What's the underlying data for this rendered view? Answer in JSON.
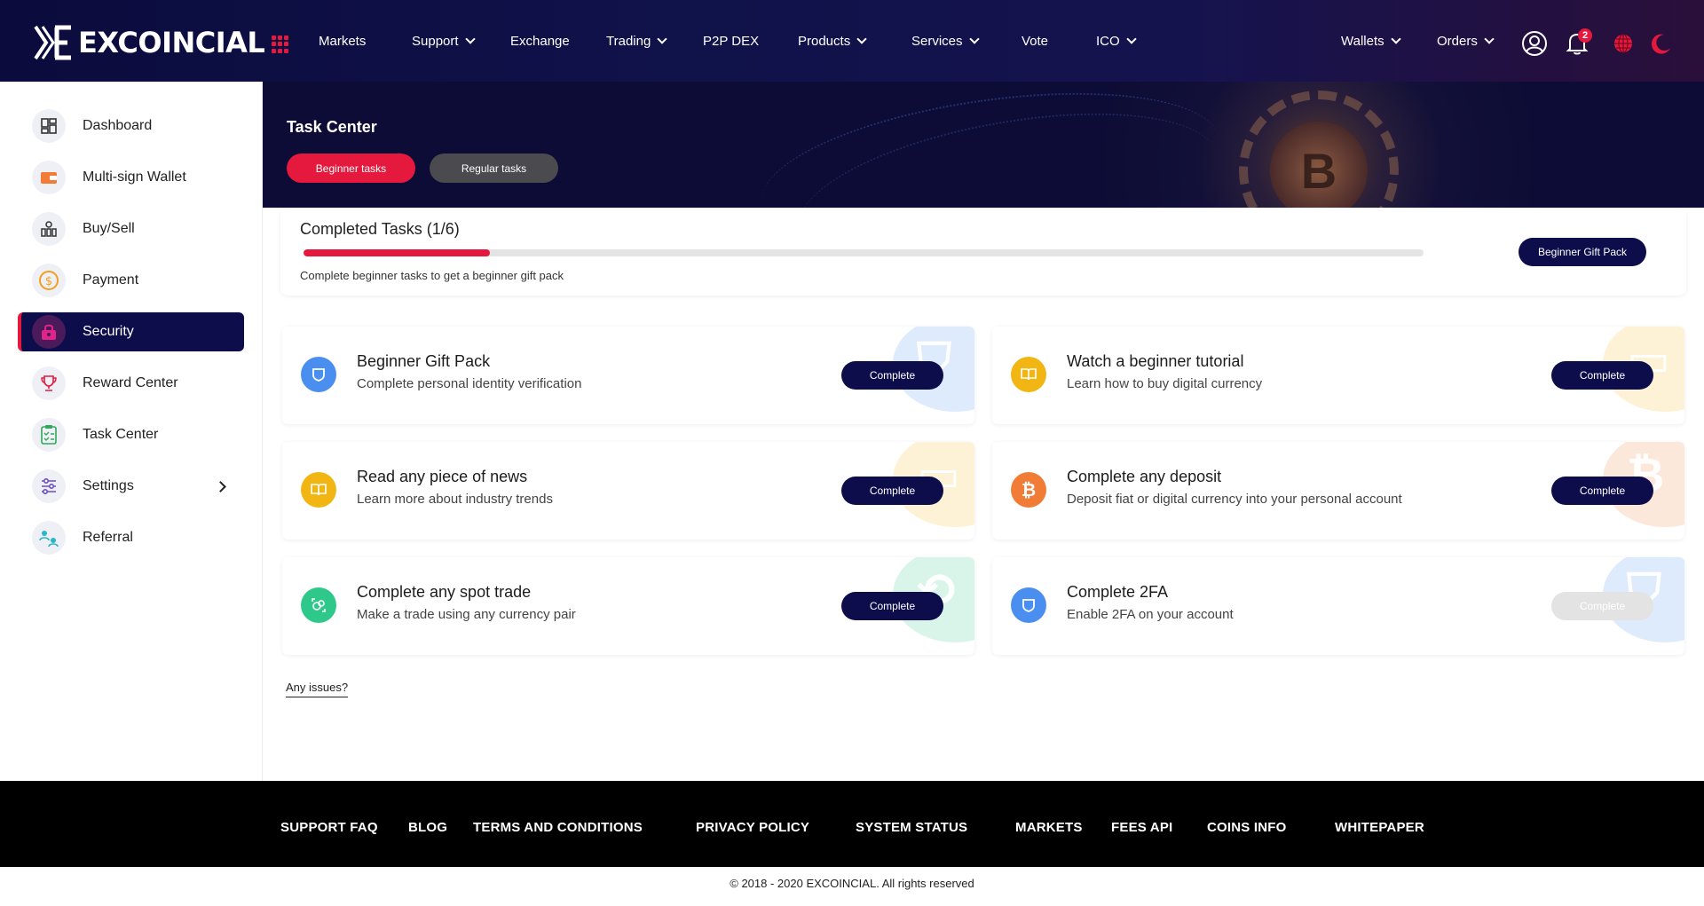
{
  "brand": {
    "name": "EXCOINCIAL"
  },
  "nav": {
    "items": [
      {
        "label": "Markets",
        "dropdown": false
      },
      {
        "label": "Support",
        "dropdown": true
      },
      {
        "label": "Exchange",
        "dropdown": false
      },
      {
        "label": "Trading",
        "dropdown": true
      },
      {
        "label": "P2P DEX",
        "dropdown": false
      },
      {
        "label": "Products",
        "dropdown": true
      },
      {
        "label": "Services",
        "dropdown": true
      },
      {
        "label": "Vote",
        "dropdown": false
      },
      {
        "label": "ICO",
        "dropdown": true
      }
    ],
    "right": [
      {
        "label": "Wallets",
        "dropdown": true
      },
      {
        "label": "Orders",
        "dropdown": true
      }
    ],
    "notification_count": "2",
    "icons": [
      "apps-grid-icon",
      "user-icon",
      "bell-icon",
      "globe-icon",
      "moon-icon"
    ]
  },
  "sidebar": {
    "items": [
      {
        "label": "Dashboard",
        "icon": "dashboard-icon",
        "active": false
      },
      {
        "label": "Multi-sign Wallet",
        "icon": "wallet-icon",
        "active": false
      },
      {
        "label": "Buy/Sell",
        "icon": "coins-icon",
        "active": false
      },
      {
        "label": "Payment",
        "icon": "dollar-icon",
        "active": false
      },
      {
        "label": "Security",
        "icon": "lock-icon",
        "active": true
      },
      {
        "label": "Reward Center",
        "icon": "trophy-icon",
        "active": false
      },
      {
        "label": "Task Center",
        "icon": "clipboard-icon",
        "active": false
      },
      {
        "label": "Settings",
        "icon": "sliders-icon",
        "active": false
      },
      {
        "label": "Referral",
        "icon": "referral-icon",
        "active": false
      }
    ]
  },
  "main": {
    "title": "Task Center",
    "tabs": [
      {
        "label": "Beginner tasks",
        "active": true
      },
      {
        "label": "Regular tasks",
        "active": false
      }
    ],
    "progress": {
      "title": "Completed Tasks (1/6)",
      "completed": 1,
      "total": 6,
      "subtitle": "Complete beginner tasks to get a beginner gift pack",
      "button": "Beginner Gift Pack"
    },
    "tasks": [
      {
        "title": "Beginner Gift Pack",
        "subtitle": "Complete personal identity verification",
        "button": "Complete",
        "icon": "shield-icon",
        "color": "#4a8ff0",
        "disabled": false
      },
      {
        "title": "Watch a beginner tutorial",
        "subtitle": "Learn how to buy digital currency",
        "button": "Complete",
        "icon": "book-icon",
        "color": "#f2b614",
        "disabled": false
      },
      {
        "title": "Read any piece of news",
        "subtitle": "Learn more about industry trends",
        "button": "Complete",
        "icon": "book-icon",
        "color": "#f2b614",
        "disabled": false
      },
      {
        "title": "Complete any deposit",
        "subtitle": "Deposit fiat or digital currency into your personal account",
        "button": "Complete",
        "icon": "bitcoin-icon",
        "color": "#f07c35",
        "disabled": false
      },
      {
        "title": "Complete any spot trade",
        "subtitle": "Make a trade using any currency pair",
        "button": "Complete",
        "icon": "trade-icon",
        "color": "#2ec98a",
        "disabled": false
      },
      {
        "title": "Complete 2FA",
        "subtitle": "Enable 2FA on your account",
        "button": "Complete",
        "icon": "shield-icon",
        "color": "#4a8ff0",
        "disabled": true
      }
    ],
    "issues_link": "Any issues?"
  },
  "footer": {
    "links": [
      "SUPPORT FAQ",
      "BLOG",
      "TERMS AND CONDITIONS",
      "PRIVACY POLICY",
      "SYSTEM STATUS",
      "MARKETS",
      "FEES API",
      "COINS INFO",
      "WHITEPAPER"
    ],
    "copyright": "© 2018 - 2020 EXCOINCIAL. All rights reserved"
  },
  "colors": {
    "accent": "#e5193d",
    "navy": "#0e0d4b"
  }
}
